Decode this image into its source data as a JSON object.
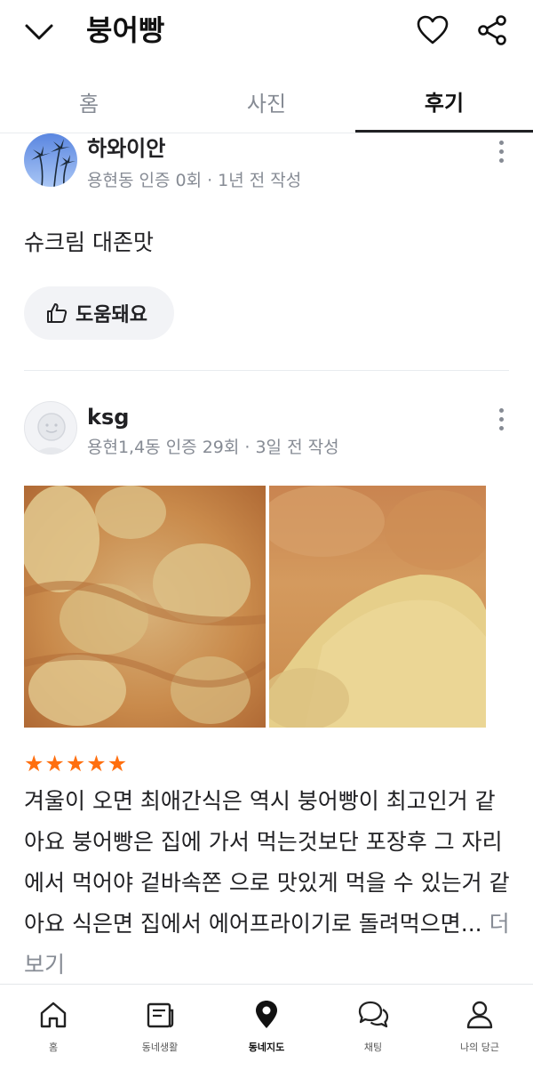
{
  "header": {
    "title": "붕어빵"
  },
  "tabs": [
    {
      "label": "홈"
    },
    {
      "label": "사진"
    },
    {
      "label": "후기"
    }
  ],
  "reviews": [
    {
      "author": "하와이안",
      "meta": "용현동 인증 0회 · 1년 전 작성",
      "text": "슈크림 대존맛",
      "helpful_label": "도움돼요"
    },
    {
      "author": "ksg",
      "meta": "용현1,4동 인증 29회 · 3일 전 작성",
      "rating": 5,
      "text": "겨울이 오면 최애간식은 역시 붕어빵이 최고인거 같아요 붕어빵은 집에 가서 먹는것보단 포장후 그 자리에서 먹어야 겉바속쫀 으로 맛있게 먹을 수 있는거 같아요 식은면 집에서 에어프라이기로 돌려먹으면...",
      "more_label": "더보기"
    }
  ],
  "bottom_nav": [
    {
      "label": "홈",
      "icon": "home-icon"
    },
    {
      "label": "동네생활",
      "icon": "newspaper-icon"
    },
    {
      "label": "동네지도",
      "icon": "map-pin-icon",
      "active": true
    },
    {
      "label": "채팅",
      "icon": "chat-icon"
    },
    {
      "label": "나의 당근",
      "icon": "person-icon"
    }
  ],
  "colors": {
    "accent": "#ff6f0f",
    "muted": "#868b94",
    "text": "#212124"
  }
}
